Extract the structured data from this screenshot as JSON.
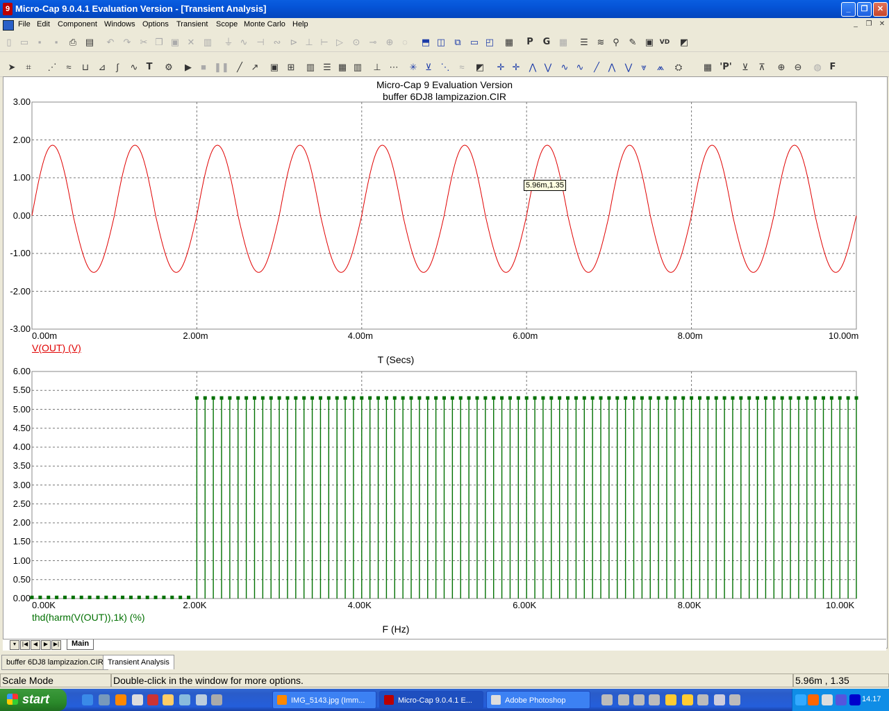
{
  "window": {
    "title": "Micro-Cap 9.0.4.1 Evaluation Version - [Transient Analysis]",
    "minimize": "_",
    "maximize": "❐",
    "close": "✕"
  },
  "menu": [
    "File",
    "Edit",
    "Component",
    "Windows",
    "Options",
    "Transient",
    "Scope",
    "Monte Carlo",
    "Help"
  ],
  "mdi_controls": [
    "_",
    "❐",
    "✕"
  ],
  "plot": {
    "title": "Micro-Cap 9 Evaluation Version",
    "subtitle": "buffer 6DJ8 lampizazion.CIR",
    "tooltip": "5.96m,1.35",
    "upper": {
      "y_ticks": [
        "3.00",
        "2.00",
        "1.00",
        "0.00",
        "-1.00",
        "-2.00",
        "-3.00"
      ],
      "x_ticks": [
        "0.00m",
        "2.00m",
        "4.00m",
        "6.00m",
        "8.00m",
        "10.00m"
      ],
      "trace_label": "V(OUT) (V)",
      "x_label": "T (Secs)",
      "color": "#e00000"
    },
    "lower": {
      "y_ticks": [
        "6.00",
        "5.50",
        "5.00",
        "4.50",
        "4.00",
        "3.50",
        "3.00",
        "2.50",
        "2.00",
        "1.50",
        "1.00",
        "0.50",
        "0.00"
      ],
      "x_ticks": [
        "0.00K",
        "2.00K",
        "4.00K",
        "6.00K",
        "8.00K",
        "10.00K"
      ],
      "trace_label": "thd(harm(V(OUT)),1k) (%)",
      "x_label": "F (Hz)",
      "color": "#007000"
    }
  },
  "chart_data": [
    {
      "type": "line",
      "title": "Micro-Cap 9 Evaluation Version",
      "subtitle": "buffer 6DJ8 lampizazion.CIR",
      "xlabel": "T (Secs)",
      "ylabel": "",
      "xlim": [
        0,
        10
      ],
      "x_unit": "ms",
      "ylim": [
        -3,
        3
      ],
      "grid": true,
      "series": [
        {
          "name": "V(OUT) (V)",
          "frequency_khz": 1,
          "max": 1.86,
          "min": -1.5,
          "start": 0,
          "cycles": 10
        }
      ],
      "cursor": {
        "x": 5.96,
        "y": 1.35
      }
    },
    {
      "type": "bar",
      "xlabel": "F (Hz)",
      "ylabel": "",
      "xlim": [
        0,
        10000
      ],
      "ylim": [
        0,
        6
      ],
      "grid": true,
      "series": [
        {
          "name": "thd(harm(V(OUT)),1k) (%)",
          "x_start": 0,
          "x_end": 10000,
          "step": 100,
          "low_value": 0.03,
          "low_until": 1900,
          "high_value": 5.3
        }
      ]
    }
  ],
  "page_tabs": {
    "main": "Main"
  },
  "doc_tabs": [
    "buffer 6DJ8 lampizazion.CIR",
    "Transient Analysis"
  ],
  "status": {
    "mode": "Scale Mode",
    "hint": "Double-click in the window for more options.",
    "cursor": "5.96m , 1.35"
  },
  "taskbar": {
    "start": "start",
    "tasks": [
      "IMG_5143.jpg (Imm...",
      "Micro-Cap 9.0.4.1 E...",
      "Adobe Photoshop"
    ],
    "clock": "14.17"
  },
  "toolbar_text": {
    "p": "P",
    "g": "G",
    "t": "T",
    "pp": "'P'",
    "f": "F",
    "vd": "VD"
  }
}
